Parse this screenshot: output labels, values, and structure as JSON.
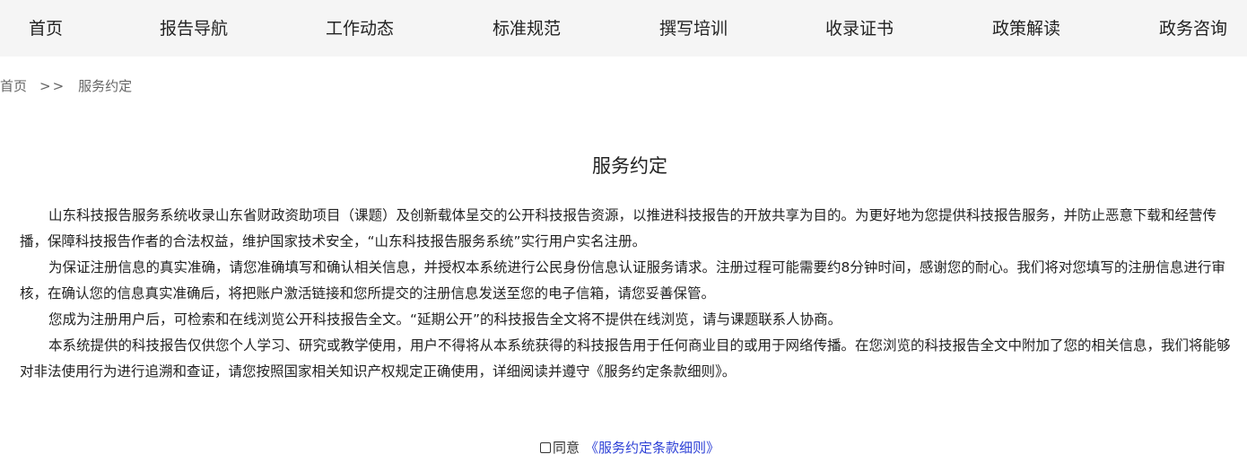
{
  "nav": {
    "items": [
      {
        "label": "首页"
      },
      {
        "label": "报告导航"
      },
      {
        "label": "工作动态"
      },
      {
        "label": "标准规范"
      },
      {
        "label": "撰写培训"
      },
      {
        "label": "收录证书"
      },
      {
        "label": "政策解读"
      },
      {
        "label": "政务咨询"
      }
    ]
  },
  "breadcrumb": {
    "home": "首页",
    "separator": ">>",
    "current": "服务约定"
  },
  "page": {
    "title": "服务约定",
    "paragraphs": [
      "山东科技报告服务系统收录山东省财政资助项目（课题）及创新载体呈交的公开科技报告资源，以推进科技报告的开放共享为目的。为更好地为您提供科技报告服务，并防止恶意下载和经营传播，保障科技报告作者的合法权益，维护国家技术安全，“山东科技报告服务系统”实行用户实名注册。",
      "为保证注册信息的真实准确，请您准确填写和确认相关信息，并授权本系统进行公民身份信息认证服务请求。注册过程可能需要约8分钟时间，感谢您的耐心。我们将对您填写的注册信息进行审核，在确认您的信息真实准确后，将把账户激活链接和您所提交的注册信息发送至您的电子信箱，请您妥善保管。",
      "您成为注册用户后，可检索和在线浏览公开科技报告全文。“延期公开”的科技报告全文将不提供在线浏览，请与课题联系人协商。",
      "本系统提供的科技报告仅供您个人学习、研究或教学使用，用户不得将从本系统获得的科技报告用于任何商业目的或用于网络传播。在您浏览的科技报告全文中附加了您的相关信息，我们将能够对非法使用行为进行追溯和查证，请您按照国家相关知识产权规定正确使用，详细阅读并遵守《服务约定条款细则》。"
    ]
  },
  "agreement": {
    "checked": false,
    "label": "同意",
    "link_text": "《服务约定条款细则》"
  },
  "colors": {
    "nav_background": "#f5f5f5",
    "text": "#222222",
    "breadcrumb_text": "#666666",
    "link": "#2c3fd6"
  }
}
